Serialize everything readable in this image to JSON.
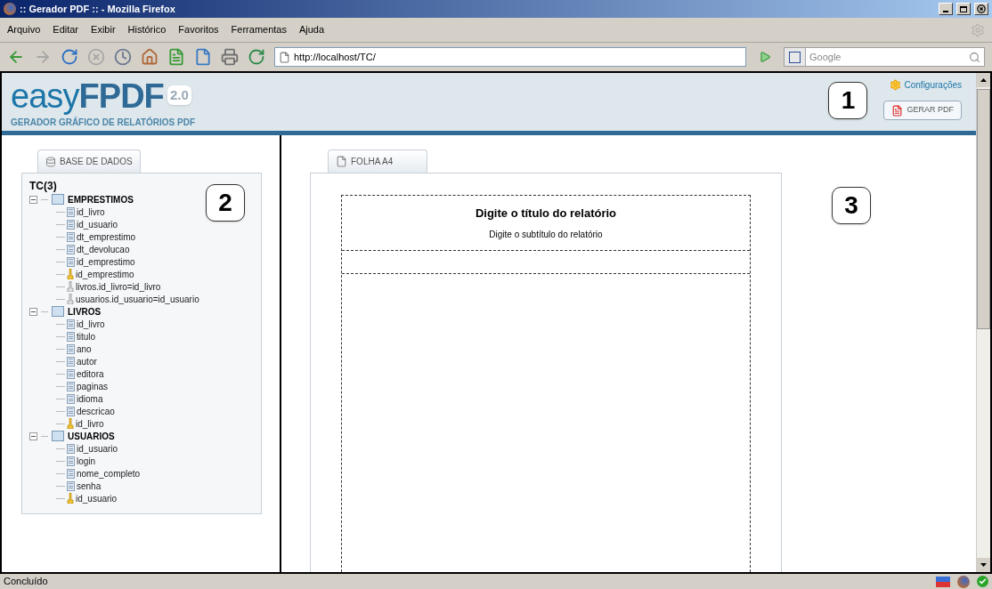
{
  "window": {
    "title": ":: Gerador PDF :: - Mozilla Firefox"
  },
  "menu": [
    "Arquivo",
    "Editar",
    "Exibir",
    "Histórico",
    "Favoritos",
    "Ferramentas",
    "Ajuda"
  ],
  "address": {
    "value": "http://localhost/TC/"
  },
  "search": {
    "placeholder": "Google"
  },
  "header": {
    "logo_light": "easy",
    "logo_bold": "FPDF",
    "version": "2.0",
    "tagline": "GERADOR GRÁFICO DE RELATÓRIOS PDF",
    "settings_link": "Configurações",
    "generate_button": "GERAR PDF"
  },
  "callouts": [
    "1",
    "2",
    "3"
  ],
  "database_panel": {
    "tab": "BASE DE DADOS",
    "root": "TC(3)",
    "tables": [
      {
        "name": "EMPRESTIMOS",
        "expanded": true,
        "children": [
          {
            "kind": "field",
            "label": "id_livro"
          },
          {
            "kind": "field",
            "label": "id_usuario"
          },
          {
            "kind": "field",
            "label": "dt_emprestimo"
          },
          {
            "kind": "field",
            "label": "dt_devolucao"
          },
          {
            "kind": "field",
            "label": "id_emprestimo"
          },
          {
            "kind": "key",
            "label": "id_emprestimo"
          },
          {
            "kind": "relation",
            "label": "livros.id_livro=id_livro"
          },
          {
            "kind": "relation",
            "label": "usuarios.id_usuario=id_usuario"
          }
        ]
      },
      {
        "name": "LIVROS",
        "expanded": true,
        "children": [
          {
            "kind": "field",
            "label": "id_livro"
          },
          {
            "kind": "field",
            "label": "titulo"
          },
          {
            "kind": "field",
            "label": "ano"
          },
          {
            "kind": "field",
            "label": "autor"
          },
          {
            "kind": "field",
            "label": "editora"
          },
          {
            "kind": "field",
            "label": "paginas"
          },
          {
            "kind": "field",
            "label": "idioma"
          },
          {
            "kind": "field",
            "label": "descricao"
          },
          {
            "kind": "key",
            "label": "id_livro"
          }
        ]
      },
      {
        "name": "USUARIOS",
        "expanded": true,
        "children": [
          {
            "kind": "field",
            "label": "id_usuario"
          },
          {
            "kind": "field",
            "label": "login"
          },
          {
            "kind": "field",
            "label": "nome_completo"
          },
          {
            "kind": "field",
            "label": "senha"
          },
          {
            "kind": "key",
            "label": "id_usuario"
          }
        ]
      }
    ]
  },
  "sheet": {
    "tab": "FOLHA A4",
    "title": "Digite o título do relatório",
    "subtitle": "Digite o subtítulo do relatório"
  },
  "status_bar": {
    "text": "Concluído"
  }
}
